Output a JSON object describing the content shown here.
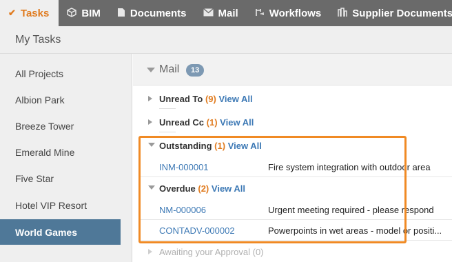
{
  "nav": {
    "tabs": [
      {
        "label": "Tasks",
        "icon": "check-icon"
      },
      {
        "label": "BIM",
        "icon": "cube-icon"
      },
      {
        "label": "Documents",
        "icon": "document-icon"
      },
      {
        "label": "Mail",
        "icon": "envelope-icon"
      },
      {
        "label": "Workflows",
        "icon": "workflow-icon"
      },
      {
        "label": "Supplier Documents",
        "icon": "building-icon"
      }
    ]
  },
  "header": {
    "title": "My Tasks"
  },
  "sidebar": {
    "items": [
      {
        "label": "All Projects"
      },
      {
        "label": "Albion Park"
      },
      {
        "label": "Breeze Tower"
      },
      {
        "label": "Emerald Mine"
      },
      {
        "label": "Five Star"
      },
      {
        "label": "Hotel VIP Resort"
      },
      {
        "label": "World Games"
      }
    ],
    "selected": "World Games"
  },
  "mail": {
    "label": "Mail",
    "badge": "13",
    "groups": {
      "unread_to": {
        "label": "Unread To",
        "count": "(9)",
        "view_all": "View All"
      },
      "unread_cc": {
        "label": "Unread Cc",
        "count": "(1)",
        "view_all": "View All"
      },
      "outstanding": {
        "label": "Outstanding",
        "count": "(1)",
        "view_all": "View All"
      },
      "overdue": {
        "label": "Overdue",
        "count": "(2)",
        "view_all": "View All"
      }
    },
    "outstanding_items": [
      {
        "id": "INM-000001",
        "subject": "Fire system integration with outdoor area"
      }
    ],
    "overdue_items": [
      {
        "id": "NM-000006",
        "subject": "Urgent meeting required - please respond"
      },
      {
        "id": "CONTADV-000002",
        "subject": "Powerpoints in wet areas - model or positi..."
      }
    ],
    "awaiting": "Awaiting your Approval (0)"
  },
  "colors": {
    "accent": "#e07b1f",
    "highlight": "#f08a24",
    "selected": "#4f7898",
    "link": "#3d79b5"
  }
}
